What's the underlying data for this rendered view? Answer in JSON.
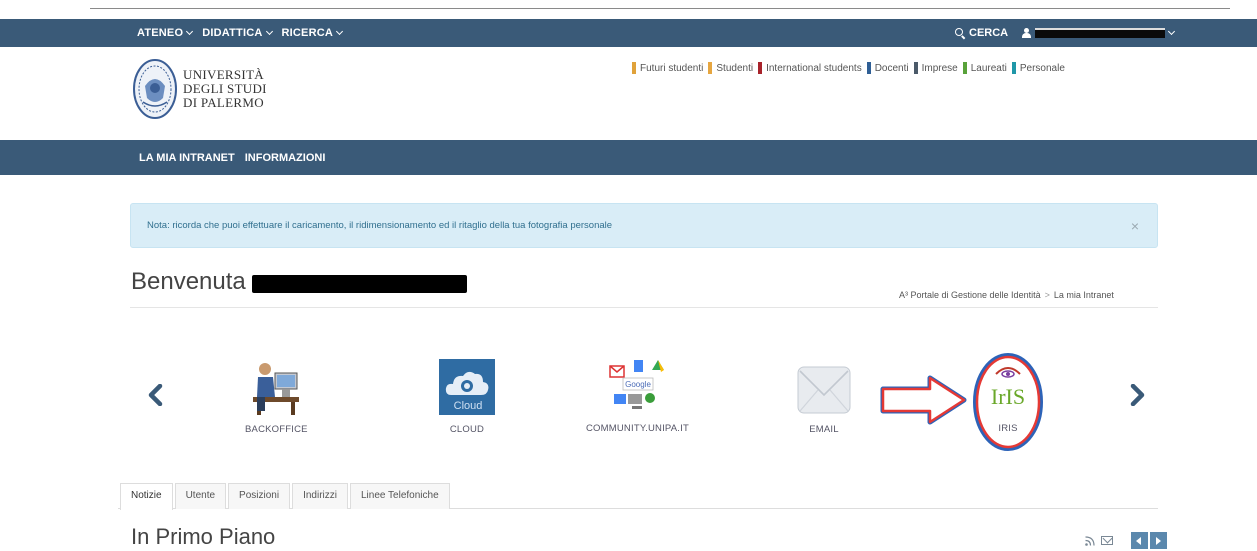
{
  "topbar": {
    "menu": [
      {
        "label": "ATENEO"
      },
      {
        "label": "DIDATTICA"
      },
      {
        "label": "RICERCA"
      }
    ],
    "search_label": "CERCA",
    "user_icon": "user-icon"
  },
  "logo": {
    "line1": "UNIVERSITÀ",
    "line2": "DEGLI STUDI",
    "line3": "DI PALERMO"
  },
  "audience": [
    {
      "label": "Futuri studenti",
      "color": "#e0a23a"
    },
    {
      "label": "Studenti",
      "color": "#e6a640"
    },
    {
      "label": "International students",
      "color": "#a8232b"
    },
    {
      "label": "Docenti",
      "color": "#2f5f95"
    },
    {
      "label": "Imprese",
      "color": "#4b5a69"
    },
    {
      "label": "Laureati",
      "color": "#59a23a"
    },
    {
      "label": "Personale",
      "color": "#1f97a8"
    }
  ],
  "nav": {
    "items": [
      {
        "label": "LA MIA INTRANET"
      },
      {
        "label": "INFORMAZIONI"
      }
    ]
  },
  "alert": {
    "message": "Nota: ricorda che puoi effettuare il caricamento, il ridimensionamento ed il ritaglio della tua fotografia personale",
    "close": "×"
  },
  "welcome": {
    "word": "Benvenuta"
  },
  "breadcrumb": {
    "home": "A³ Portale di Gestione delle Identità",
    "separator": ">",
    "current": "La mia Intranet"
  },
  "apps": [
    {
      "label": "BACKOFFICE",
      "icon": "backoffice-icon"
    },
    {
      "label": "CLOUD",
      "icon": "cloud-icon"
    },
    {
      "label": "COMMUNITY.UNIPA.IT",
      "icon": "community-icon"
    },
    {
      "label": "EMAIL",
      "icon": "email-icon"
    },
    {
      "label": "IRIS",
      "icon": "iris-icon"
    }
  ],
  "cloud_text": "Cloud",
  "google_text": "Google",
  "iris_text": "IrIS",
  "tabs": [
    {
      "label": "Notizie",
      "active": true
    },
    {
      "label": "Utente"
    },
    {
      "label": "Posizioni"
    },
    {
      "label": "Indirizzi"
    },
    {
      "label": "Linee Telefoniche"
    }
  ],
  "section": {
    "title": "In Primo Piano"
  },
  "colors": {
    "navbar": "#3a5a78",
    "alert_bg": "#d9edf7",
    "alert_text": "#31708f",
    "annotation_red": "#e53935",
    "annotation_blue": "#2d63b8"
  }
}
